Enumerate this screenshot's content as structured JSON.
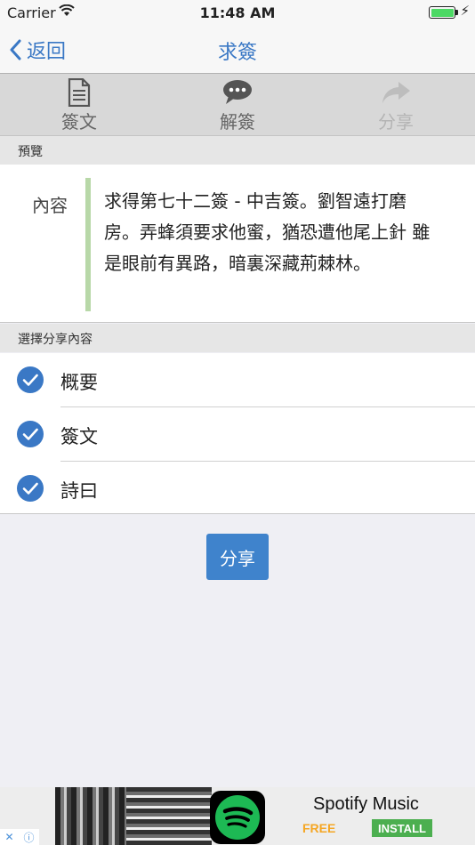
{
  "status_bar": {
    "carrier": "Carrier",
    "time": "11:48 AM",
    "battery_level": 1.0
  },
  "nav": {
    "back_label": "返回",
    "title": "求簽"
  },
  "toolbar": {
    "items": [
      {
        "label": "簽文",
        "icon": "document-icon",
        "enabled": true
      },
      {
        "label": "解簽",
        "icon": "chat-bubble-icon",
        "enabled": true
      },
      {
        "label": "分享",
        "icon": "share-arrow-icon",
        "enabled": false
      }
    ]
  },
  "preview": {
    "header": "預覽",
    "label": "內容",
    "text": "求得第七十二簽 - 中吉簽。劉智遠打磨房。弄蜂須要求他蜜，猶恐遭他尾上針 雖是眼前有異路，暗裏深藏荊棘林。"
  },
  "share_options": {
    "header": "選擇分享內容",
    "items": [
      {
        "label": "概要",
        "checked": true
      },
      {
        "label": "簽文",
        "checked": true
      },
      {
        "label": "詩曰",
        "checked": true
      }
    ]
  },
  "share_button": {
    "label": "分享"
  },
  "ad": {
    "title": "Spotify Music",
    "price": "FREE",
    "cta": "INSTALL"
  },
  "colors": {
    "accent": "#3a78c5",
    "button": "#3f83cc",
    "quote_bar": "#b8d8a8",
    "check": "#3a78c5"
  }
}
